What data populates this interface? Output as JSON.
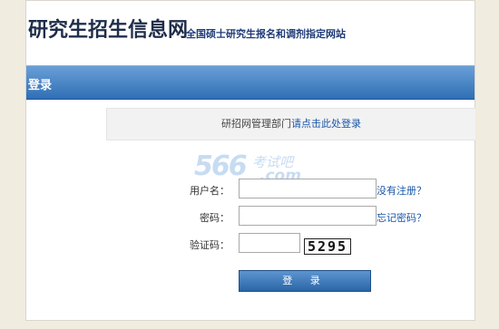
{
  "header": {
    "logo_text": "研究生招生信息网",
    "tagline": "全国硕士研究生报名和调剂指定网站"
  },
  "login_bar": {
    "title": "登录"
  },
  "notice": {
    "prefix": "研招网管理部门",
    "link_text": "请点击此处登录"
  },
  "watermark": {
    "number": "566",
    "text": "考试吧",
    "domain": ".com"
  },
  "form": {
    "username": {
      "label": "用户名：",
      "value": "",
      "link": "没有注册？"
    },
    "password": {
      "label": "密码：",
      "value": "",
      "link": "忘记密码？"
    },
    "captcha": {
      "label": "验证码：",
      "value": "",
      "image_text": "5295"
    },
    "submit_label": "登 录"
  },
  "colors": {
    "page_bg": "#f1ece0",
    "bar_top": "#6a9fd6",
    "bar_bottom": "#2f6fb5",
    "link": "#1b57a8",
    "logo": "#1f2d4a"
  }
}
